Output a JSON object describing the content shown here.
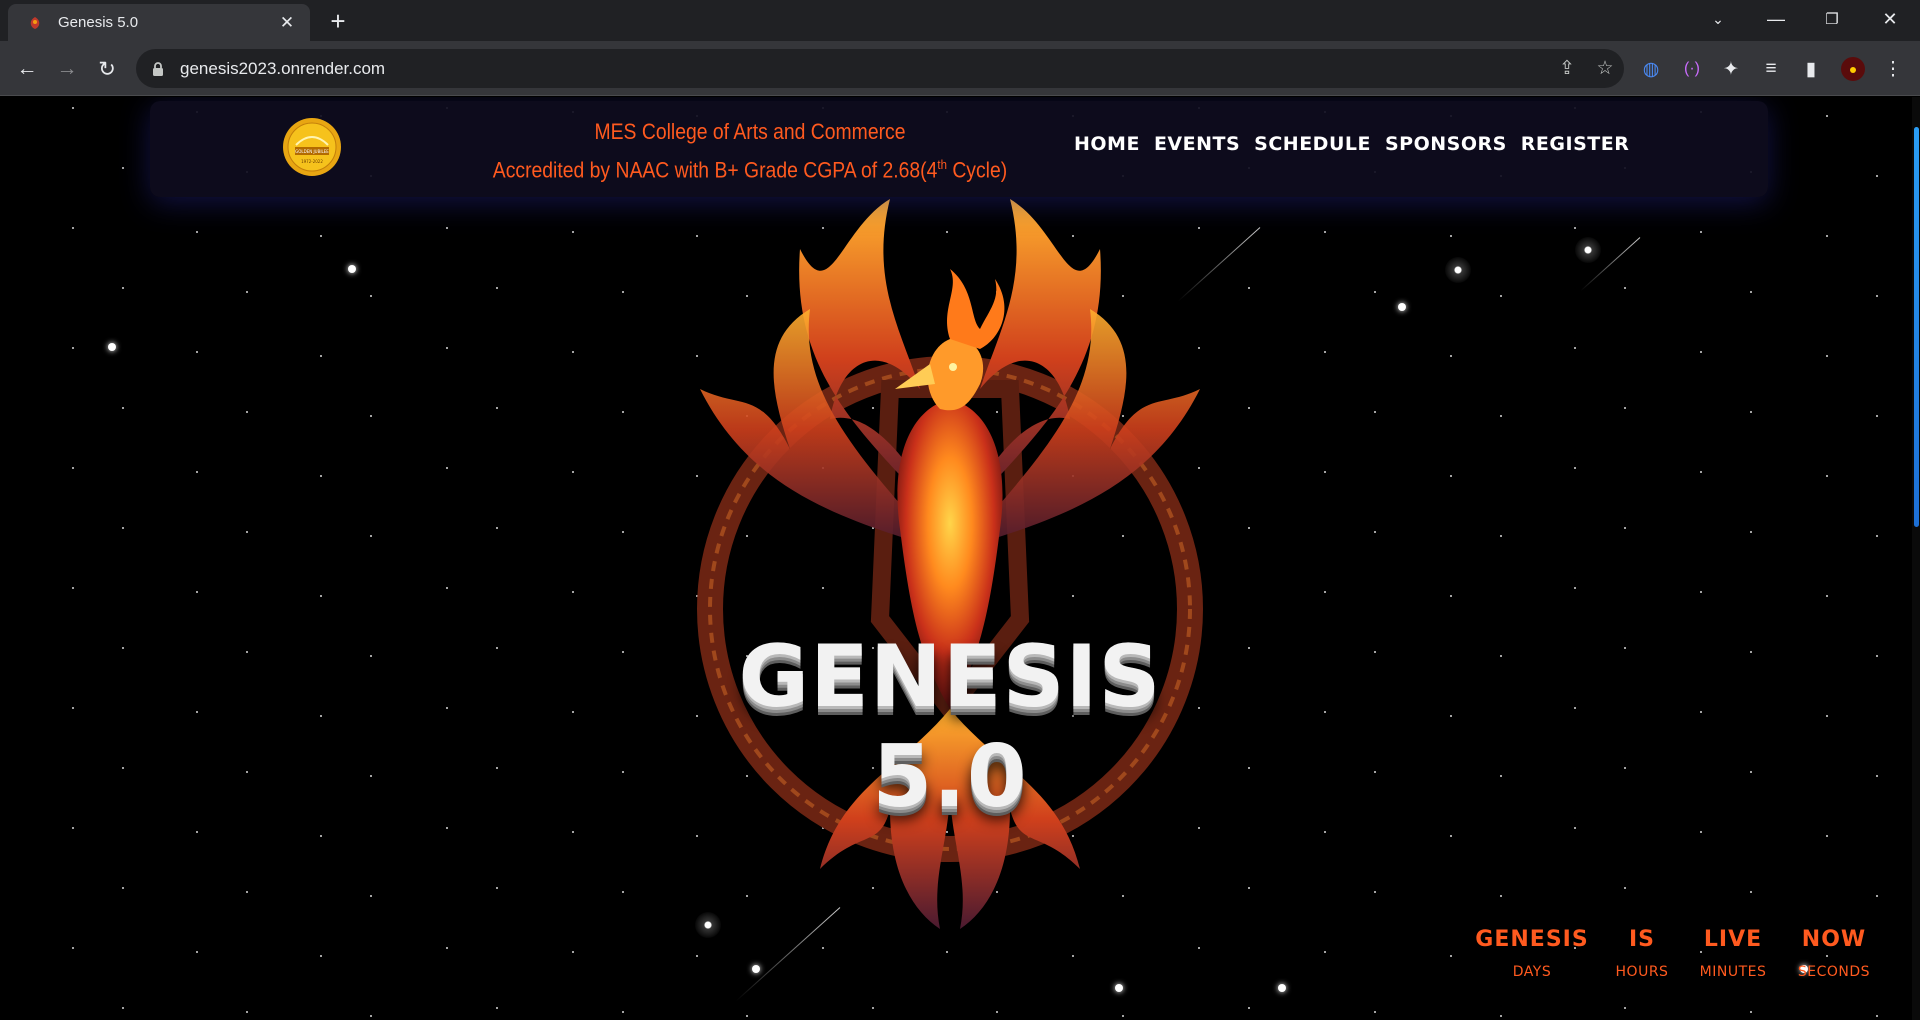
{
  "browser": {
    "tab_title": "Genesis 5.0",
    "url": "genesis2023.onrender.com"
  },
  "header": {
    "college_line1": "MES College of Arts and Commerce",
    "college_line2_prefix": "Accredited by NAAC with B+ Grade CGPA of 2.68(4",
    "college_line2_sup": "th",
    "college_line2_suffix": " Cycle)",
    "logo_text_top": "GOLDEN JUBILEE",
    "logo_text_bottom": "1972-2022"
  },
  "nav": [
    "HOME",
    "EVENTS",
    "SCHEDULE",
    "SPONSORS",
    "REGISTER"
  ],
  "hero": {
    "title": "GENESIS 5.0"
  },
  "countdown": {
    "words": [
      "GENESIS",
      "IS",
      "LIVE",
      "NOW"
    ],
    "labels": [
      "DAYS",
      "HOURS",
      "MINUTES",
      "SECONDS"
    ]
  },
  "colors": {
    "accent": "#ff5a1f",
    "background": "#000000",
    "header_bg": "#0e0c1e"
  }
}
